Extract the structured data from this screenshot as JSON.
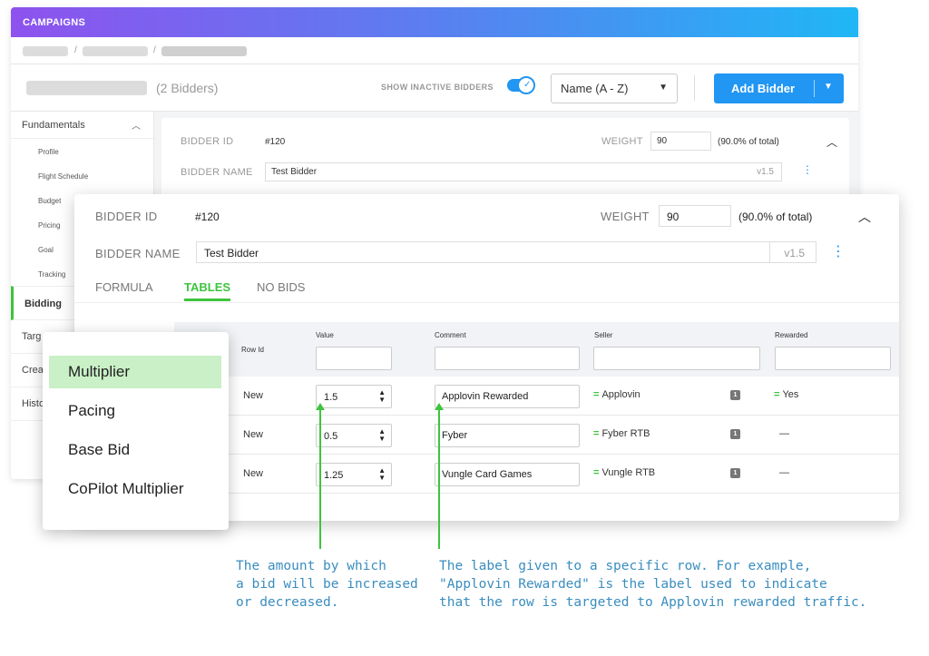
{
  "topbar": {
    "title": "CAMPAIGNS"
  },
  "header": {
    "bidders_count": "(2 Bidders)",
    "show_inactive_label": "SHOW INACTIVE BIDDERS",
    "sort_value": "Name (A - Z)",
    "add_bidder_label": "Add Bidder",
    "colors": {
      "accent": "#2196f3",
      "active_green": "#3ec43e"
    }
  },
  "sidebar": {
    "group": "Fundamentals",
    "sub_items": [
      "Profile",
      "Flight Schedule",
      "Budget",
      "Pricing",
      "Goal",
      "Tracking"
    ],
    "active": "Bidding",
    "items_partial": [
      "Targ",
      "Crea",
      "Histo"
    ]
  },
  "bg_card": {
    "bidder_id_label": "BIDDER ID",
    "bidder_id": "#120",
    "weight_label": "WEIGHT",
    "weight": "90",
    "weight_pct": "(90.0% of total)",
    "bidder_name_label": "BIDDER NAME",
    "bidder_name": "Test Bidder",
    "version": "v1.5"
  },
  "card": {
    "bidder_id_label": "BIDDER ID",
    "bidder_id": "#120",
    "weight_label": "WEIGHT",
    "weight": "90",
    "weight_pct": "(90.0% of total)",
    "bidder_name_label": "BIDDER NAME",
    "bidder_name": "Test Bidder",
    "version": "v1.5",
    "tabs": [
      "FORMULA",
      "TABLES",
      "NO BIDS"
    ],
    "active_tab": "TABLES"
  },
  "table": {
    "headers": {
      "row_id": "Row Id",
      "value": "Value",
      "comment": "Comment",
      "seller": "Seller",
      "rewarded": "Rewarded"
    },
    "rows": [
      {
        "row_id": "New",
        "value": "1.5",
        "comment": "Applovin Rewarded",
        "seller": "Applovin",
        "badge": "1",
        "rewarded": "Yes"
      },
      {
        "row_id": "New",
        "value": "0.5",
        "comment": "Fyber",
        "seller": "Fyber RTB",
        "badge": "1",
        "rewarded": "—"
      },
      {
        "row_id": "New",
        "value": "1.25",
        "comment": "Vungle Card Games",
        "seller": "Vungle RTB",
        "badge": "1",
        "rewarded": "—"
      }
    ]
  },
  "popup": {
    "options": [
      "Multiplier",
      "Pacing",
      "Base Bid",
      "CoPilot Multiplier"
    ],
    "selected": "Multiplier"
  },
  "annotations": {
    "value_note": [
      "The amount by which",
      "a bid will be increased",
      "or decreased."
    ],
    "comment_note": [
      "The label given to a specific row. For example,",
      "\"Applovin Rewarded\" is the label used to indicate",
      "that the row is targeted to Applovin rewarded traffic."
    ]
  }
}
